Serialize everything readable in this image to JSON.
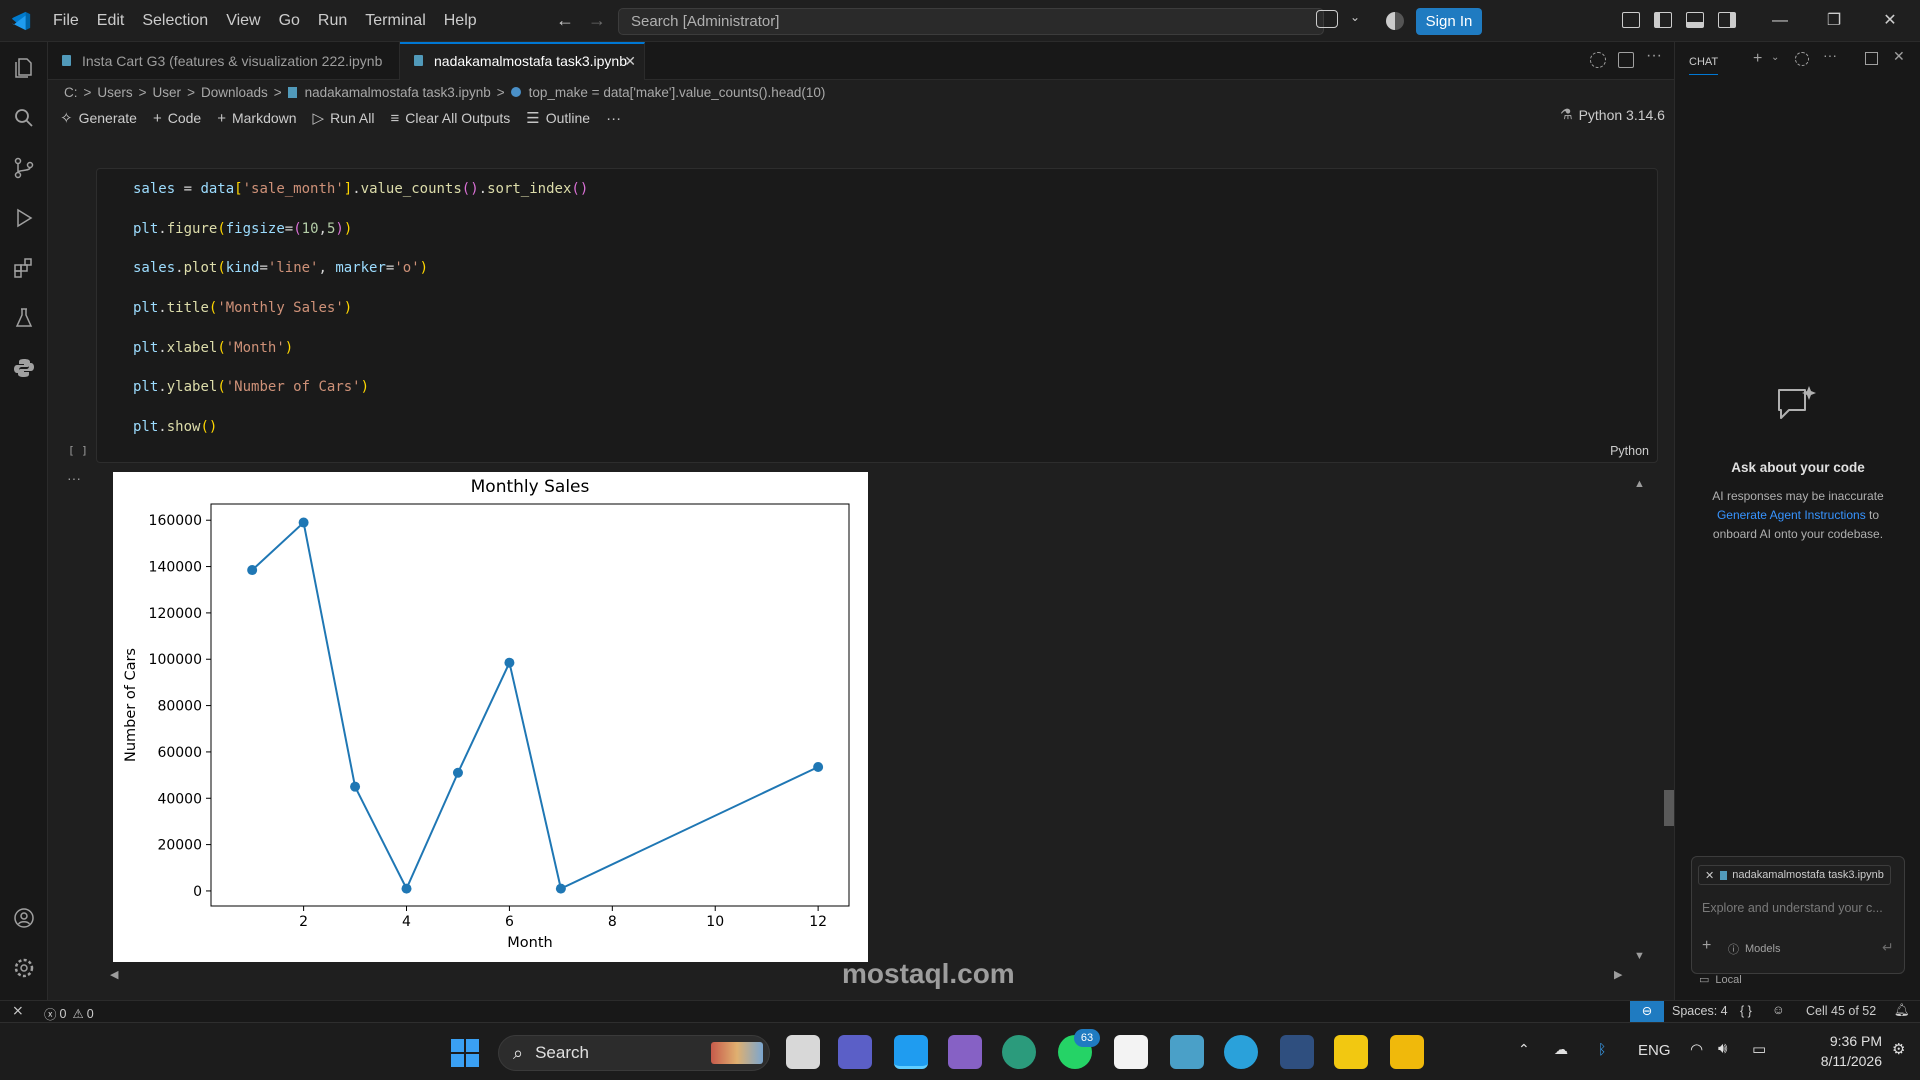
{
  "titlebar": {
    "menu": [
      "File",
      "Edit",
      "Selection",
      "View",
      "Go",
      "Run",
      "Terminal",
      "Help"
    ],
    "search_placeholder": "Search [Administrator]",
    "signin_label": "Sign In"
  },
  "tabs": [
    {
      "label": "Insta Cart G3 (features & visualization 222.ipynb"
    },
    {
      "label": "nadakamalmostafa task3.ipynb"
    }
  ],
  "breadcrumb": [
    "C:",
    ">",
    "Users",
    ">",
    "User",
    ">",
    "Downloads",
    ">",
    "nadakamalmostafa task3.ipynb",
    ">",
    "top_make = data['make'].value_counts().head(10)"
  ],
  "toolbar": {
    "generate": "Generate",
    "code": "Code",
    "markdown": "Markdown",
    "run_all": "Run All",
    "clear": "Clear All Outputs",
    "outline": "Outline",
    "kernel": "Python 3.14.6"
  },
  "cell": {
    "exec_label": "[ ]",
    "lang": "Python",
    "lines": [
      "sales = data['sale_month'].value_counts().sort_index()",
      "plt.figure(figsize=(10,5))",
      "sales.plot(kind='line', marker='o')",
      "plt.title('Monthly Sales')",
      "plt.xlabel('Month')",
      "plt.ylabel('Number of Cars')",
      "plt.show()"
    ]
  },
  "chart_data": {
    "type": "line",
    "title": "Monthly Sales",
    "xlabel": "Month",
    "ylabel": "Number of Cars",
    "x": [
      1,
      2,
      3,
      4,
      5,
      6,
      7,
      12
    ],
    "values": [
      138500,
      159000,
      45000,
      1000,
      51000,
      98500,
      1000,
      53500
    ],
    "xlim": [
      0.2,
      12.6
    ],
    "ylim": [
      -6500,
      167000
    ],
    "xticks": [
      "2",
      "4",
      "6",
      "8",
      "10",
      "12"
    ],
    "yticks": [
      "0",
      "20000",
      "40000",
      "60000",
      "80000",
      "100000",
      "120000",
      "140000",
      "160000"
    ],
    "color": "#1f77b4",
    "grid": false
  },
  "chat": {
    "title": "CHAT",
    "heading": "Ask about your code",
    "desc1": "AI responses may be inaccurate",
    "link": "Generate Agent Instructions",
    "desc2": "to",
    "desc3": "onboard AI onto your codebase.",
    "attachment": "nadakamalmostafa task3.ipynb",
    "input_placeholder": "Explore and understand your c...",
    "models": "Models",
    "local": "Local"
  },
  "statusbar": {
    "errors": "0",
    "warnings": "0",
    "spaces": "Spaces: 4",
    "braces": "{ }",
    "cell_pos": "Cell 45 of 52"
  },
  "taskbar": {
    "search": "Search",
    "lang": "ENG",
    "time": "9:36 PM",
    "date": "8/11/2026",
    "badge": "63"
  },
  "watermark": "mostaql.com"
}
